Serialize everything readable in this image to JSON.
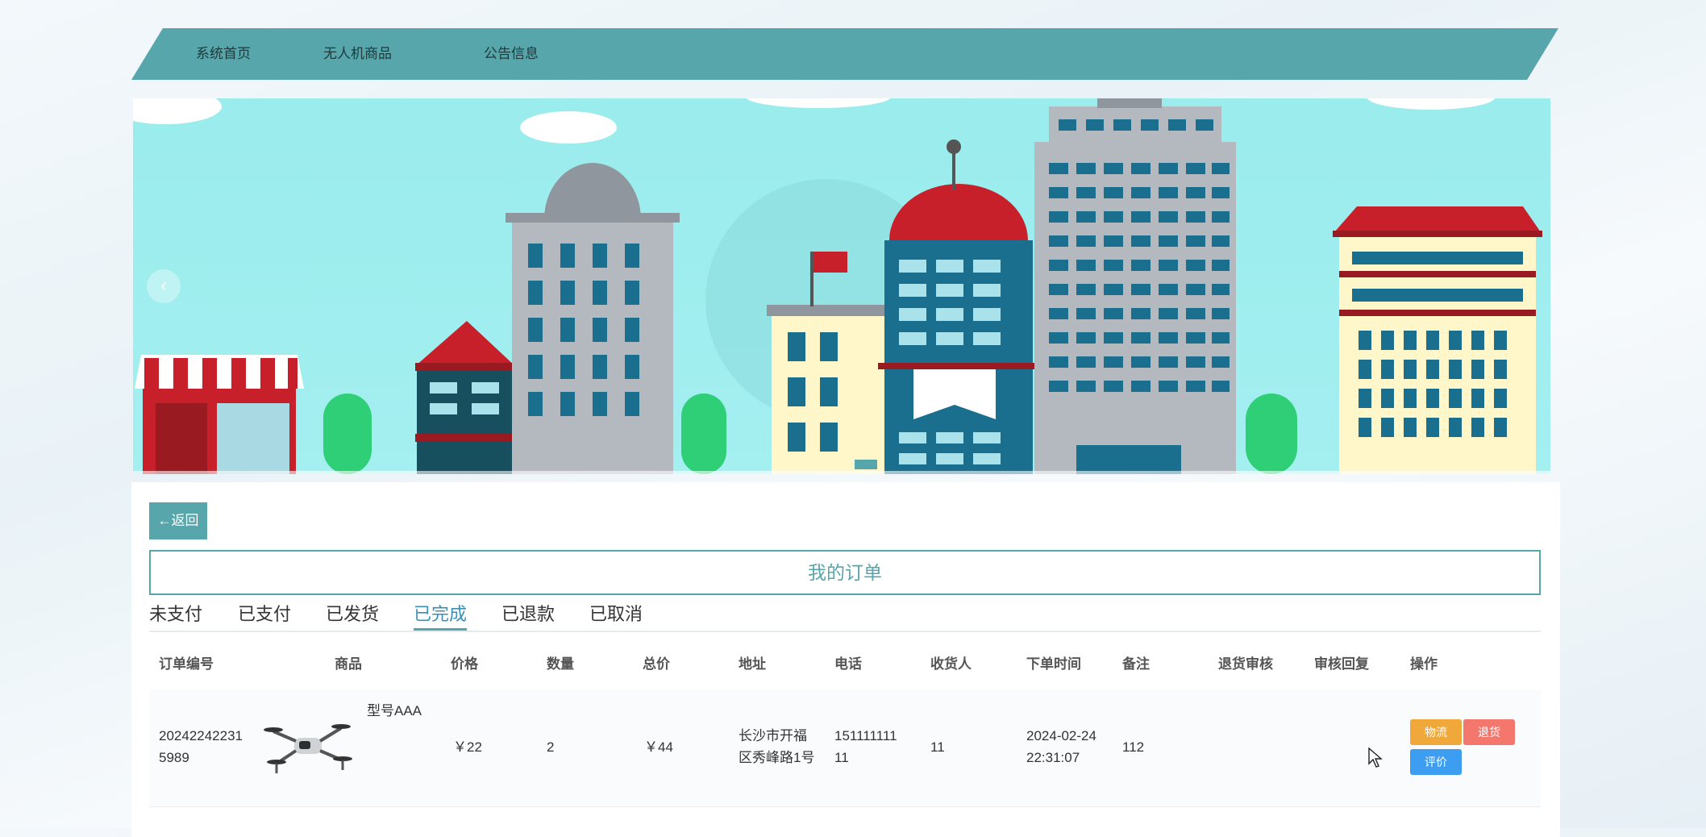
{
  "nav": {
    "items": [
      "系统首页",
      "无人机商品",
      "公告信息"
    ]
  },
  "carousel": {
    "prev_label": "‹"
  },
  "back_label": "←返回",
  "page_title": "我的订单",
  "tabs": [
    "未支付",
    "已支付",
    "已发货",
    "已完成",
    "已退款",
    "已取消"
  ],
  "active_tab": "已完成",
  "table": {
    "headers": [
      "订单编号",
      "商品",
      "价格",
      "数量",
      "总价",
      "地址",
      "电话",
      "收货人",
      "下单时间",
      "备注",
      "退货审核",
      "审核回复",
      "操作"
    ],
    "rows": [
      {
        "order_no": [
          "20242242231",
          "5989"
        ],
        "product_name": "型号AAA",
        "price": "￥22",
        "quantity": "2",
        "total": "￥44",
        "address": [
          "长沙市开福",
          "区秀峰路1号"
        ],
        "phone": [
          "151111111",
          "11"
        ],
        "receiver": "11",
        "order_time": [
          "2024-02-24",
          "22:31:07"
        ],
        "remark": "112",
        "return_audit": "",
        "audit_reply": "",
        "actions": [
          "物流",
          "退货",
          "评价"
        ]
      }
    ]
  },
  "colors": {
    "accent": "#57a6ab",
    "active_tab": "#3a8fb7",
    "logistics_btn": "#f0a83a",
    "return_btn": "#f3776d",
    "review_btn": "#3d9df0"
  }
}
